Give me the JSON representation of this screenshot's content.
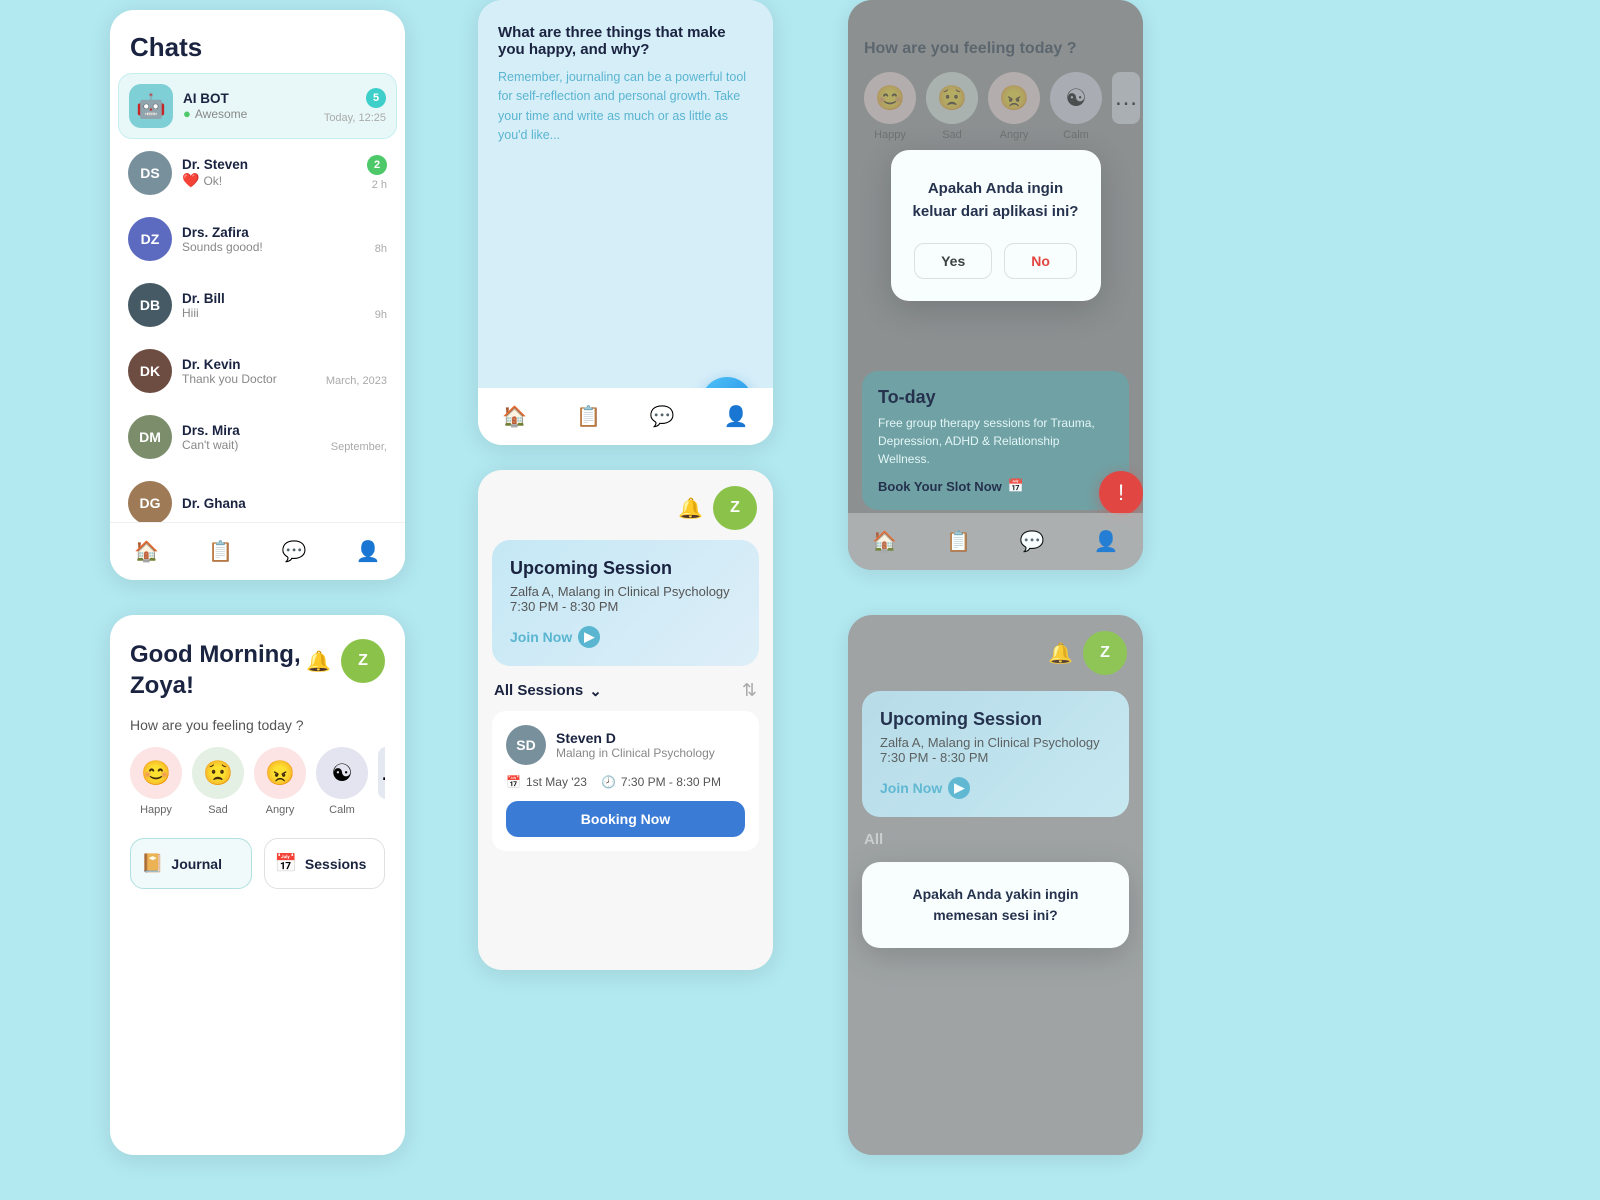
{
  "app": {
    "bg_color": "#b2e8f0"
  },
  "chats_panel": {
    "title": "Chats",
    "items": [
      {
        "name": "AI BOT",
        "status": "Awesome",
        "time": "Today, 12:25",
        "badge": "5",
        "last": "Awesome",
        "avatar_class": "bot"
      },
      {
        "name": "Dr. Steven",
        "last": "Ok!",
        "time": "2 h",
        "badge": "2",
        "avatar_class": "av-steven"
      },
      {
        "name": "Drs. Zafira",
        "last": "Sounds goood!",
        "time": "8h",
        "badge": "",
        "avatar_class": "av-zafira"
      },
      {
        "name": "Dr. Bill",
        "last": "Hiii",
        "time": "9h",
        "badge": "",
        "avatar_class": "av-bill"
      },
      {
        "name": "Dr. Kevin",
        "last": "Thank you Doctor",
        "time": "March, 2023",
        "badge": "",
        "avatar_class": "av-kevin"
      },
      {
        "name": "Drs. Mira",
        "last": "Can't wait)",
        "time": "September,",
        "badge": "",
        "avatar_class": "av-mira"
      },
      {
        "name": "Dr. Ghana",
        "last": "",
        "time": "",
        "badge": "",
        "avatar_class": "av-ghana"
      }
    ],
    "nav": [
      "🏠",
      "📋",
      "💬",
      "👤"
    ]
  },
  "journal_panel": {
    "question": "What are three things that make you happy, and why?",
    "hint": "Remember, journaling can be a powerful tool for self-reflection and personal growth. Take your time and write as much or as little as you'd like...",
    "fab_icon": "✦",
    "nav": [
      "🏠",
      "📋",
      "💬",
      "👤"
    ]
  },
  "exit_panel": {
    "how_feeling": "How are you feeling today ?",
    "moods": [
      {
        "label": "Happy",
        "emoji": "😊",
        "color": "#fce4e4"
      },
      {
        "label": "Sad",
        "emoji": "😟",
        "color": "#e4f0e4"
      },
      {
        "label": "Angry",
        "emoji": "😠",
        "color": "#fce4e4"
      },
      {
        "label": "Calm",
        "emoji": "☯",
        "color": "#e4e4f0"
      }
    ],
    "dialog_title": "Apakah Anda ingin keluar dari aplikasi ini?",
    "btn_yes": "Yes",
    "btn_no": "No",
    "today_title": "To-day",
    "today_desc": "Free group therapy sessions for Trauma, Depression, ADHD & Relationship Wellness.",
    "book_now": "Book Your Slot Now",
    "notif_icon": "!"
  },
  "morning_panel": {
    "greeting": "Good Morning,",
    "name": "Zoya!",
    "bell_icon": "🔔",
    "mood_heading": "How are you feeling today ?",
    "moods": [
      {
        "label": "Happy",
        "emoji": "😊",
        "color": "#fce4e4"
      },
      {
        "label": "Sad",
        "emoji": "😟",
        "color": "#e4f0e4"
      },
      {
        "label": "Angry",
        "emoji": "😠",
        "color": "#fce4e4"
      },
      {
        "label": "Calm",
        "emoji": "☯",
        "color": "#e4e4f0"
      }
    ],
    "quick_actions": [
      {
        "icon": "📔",
        "label": "Journal"
      },
      {
        "icon": "📅",
        "label": "Sessions"
      }
    ]
  },
  "sessions_panel": {
    "upcoming_title": "Upcoming Session",
    "upcoming_who": "Zalfa A, Malang in Clinical Psychology",
    "upcoming_time": "7:30 PM - 8:30 PM",
    "join_now": "Join Now",
    "all_sessions": "All Sessions",
    "session": {
      "doctor_name": "Steven D",
      "specialty": "Malang in Clinical Psychology",
      "date": "1st May '23",
      "time": "7:30 PM - 8:30 PM",
      "book_btn": "Booking Now"
    }
  },
  "exit2_panel": {
    "upcoming_title": "Upcoming Session",
    "upcoming_who": "Zalfa A, Malang in Clinical Psychology",
    "upcoming_time": "7:30 PM - 8:30 PM",
    "join_now": "Join Now",
    "all_sessions": "All",
    "dialog_text": "Apakah Anda yakin ingin memesan sesi ini?"
  },
  "bottom_nav_labels": {
    "home": "Home",
    "journal_tab": "Journal",
    "chat_tab": "Chat",
    "profile_tab": "Profile"
  }
}
